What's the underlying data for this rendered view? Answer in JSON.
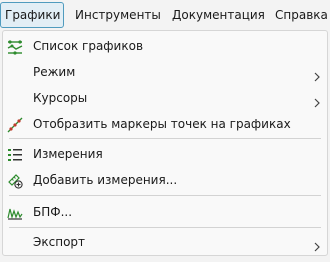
{
  "menubar": {
    "items": [
      {
        "label": "Графики"
      },
      {
        "label": "Инструменты"
      },
      {
        "label": "Документация"
      },
      {
        "label": "Справка"
      }
    ]
  },
  "menu": {
    "items": [
      {
        "label": "Список графиков",
        "icon": "graph-list-icon"
      },
      {
        "label": "Режим",
        "submenu": true
      },
      {
        "label": "Курсоры",
        "submenu": true
      },
      {
        "label": "Отобразить маркеры точек на графиках",
        "icon": "point-markers-icon"
      },
      {
        "label": "Измерения",
        "icon": "measurements-icon"
      },
      {
        "label": "Добавить измерения...",
        "icon": "add-measurement-icon"
      },
      {
        "label": "БПФ...",
        "icon": "fft-icon"
      },
      {
        "label": "Экспорт",
        "submenu": true
      }
    ]
  },
  "colors": {
    "accent": "#4f9bbe",
    "green": "#2e8b2e",
    "red": "#c0392b"
  }
}
